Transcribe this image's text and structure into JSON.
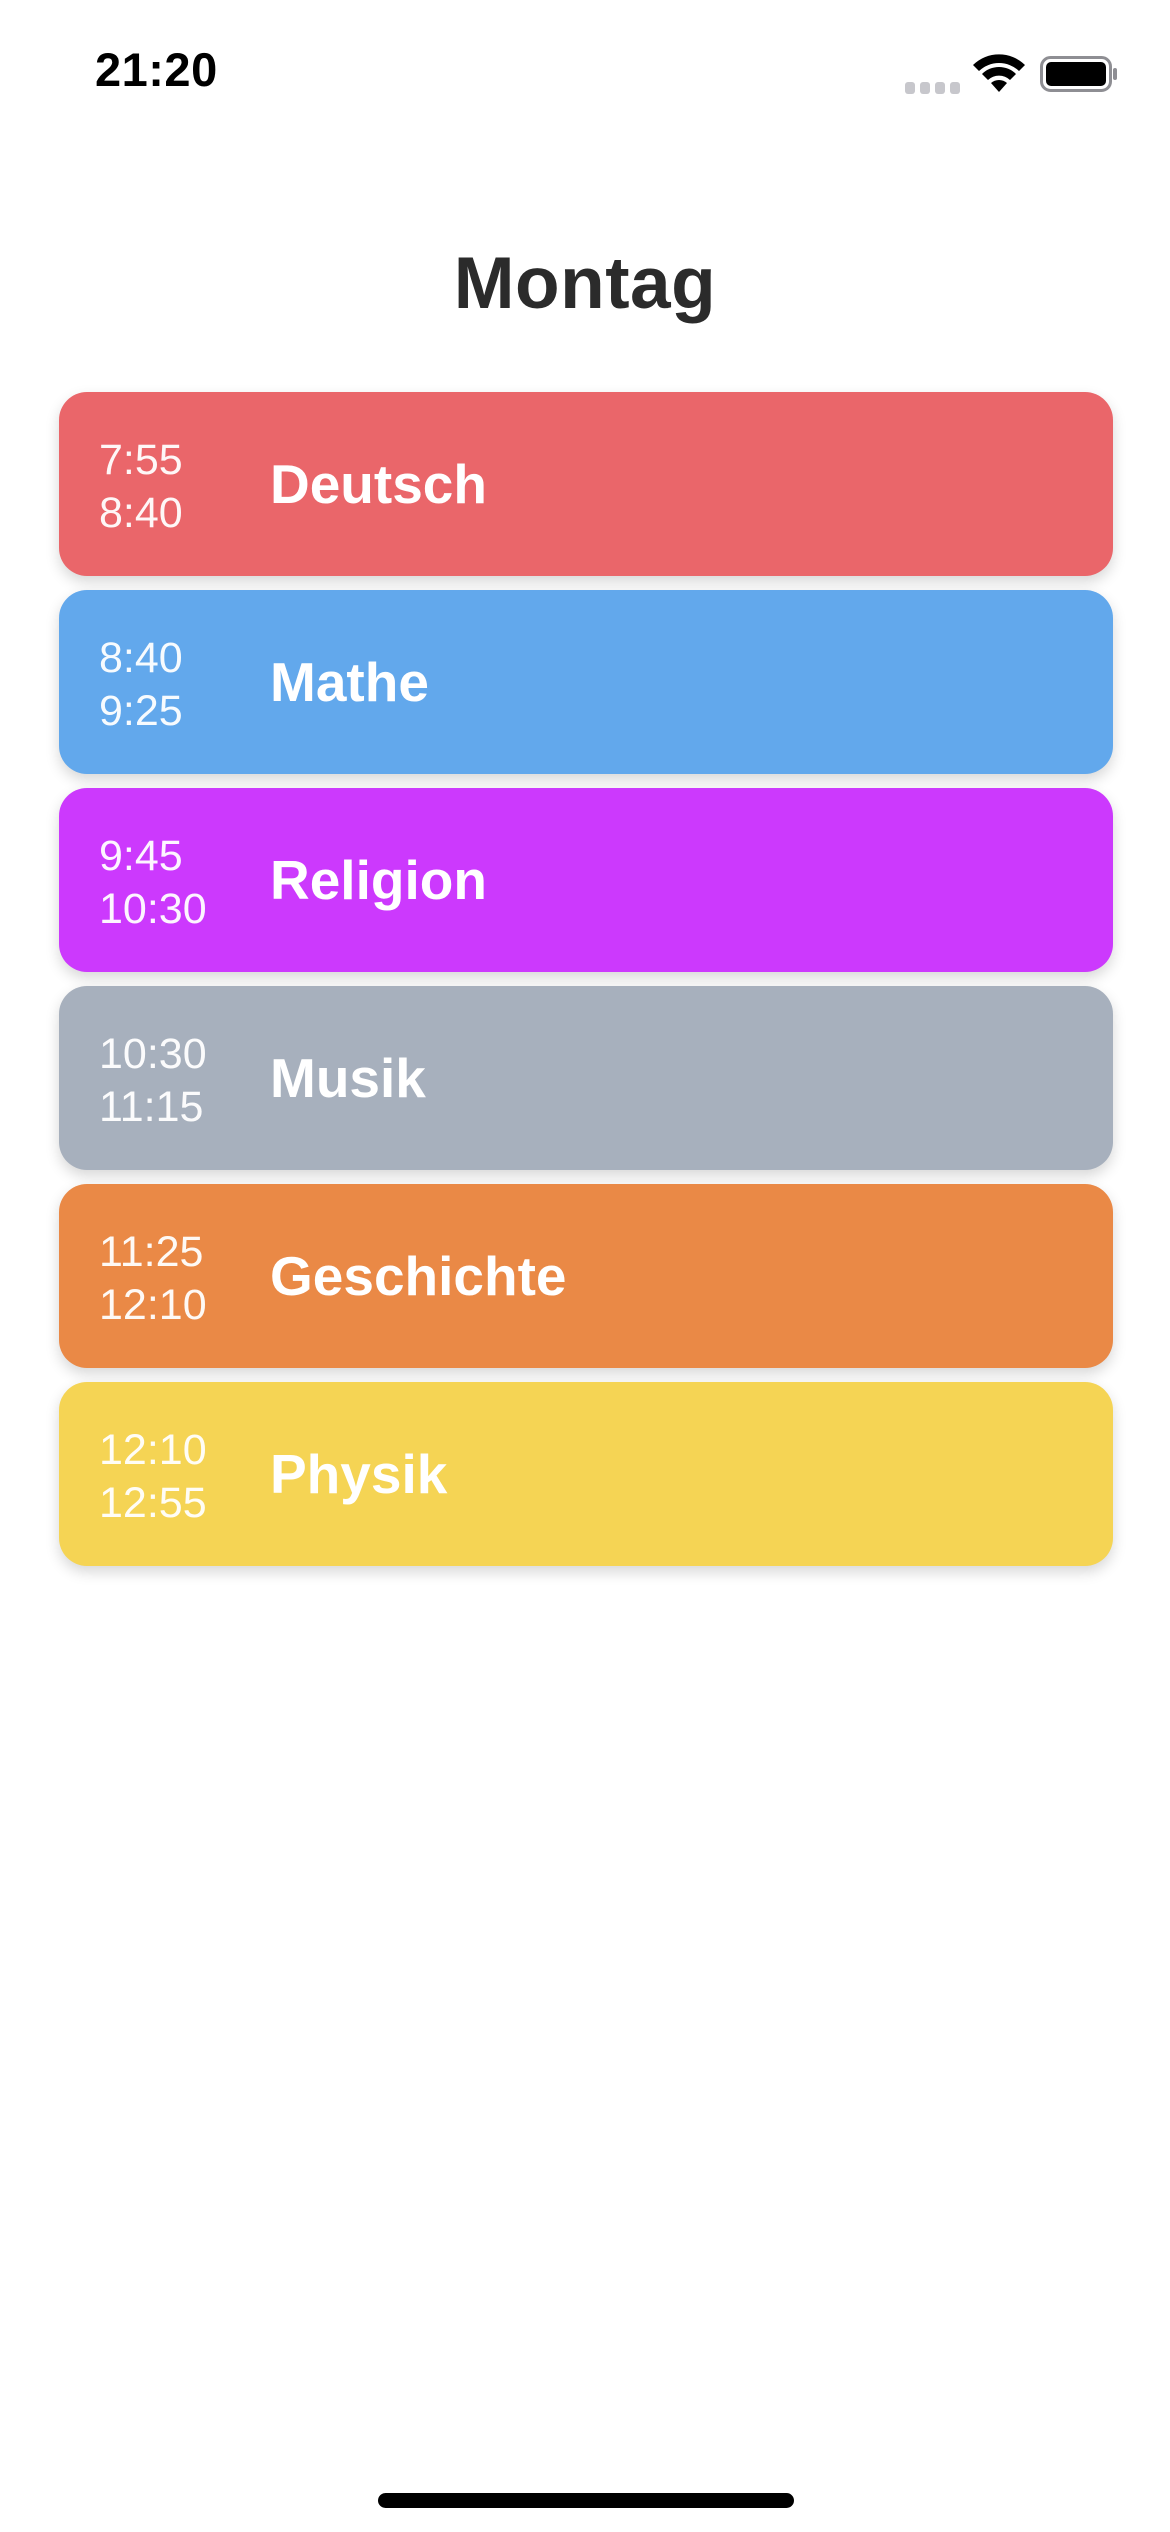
{
  "status_bar": {
    "time": "21:20",
    "icons": [
      "cellular-signal-icon",
      "wifi-icon",
      "battery-icon"
    ]
  },
  "page": {
    "title": "Montag"
  },
  "lessons": [
    {
      "start": "7:55",
      "end": "8:40",
      "subject": "Deutsch",
      "color": "#EA666A"
    },
    {
      "start": "8:40",
      "end": "9:25",
      "subject": "Mathe",
      "color": "#62A8EC"
    },
    {
      "start": "9:45",
      "end": "10:30",
      "subject": "Religion",
      "color": "#CC39FD"
    },
    {
      "start": "10:30",
      "end": "11:15",
      "subject": "Musik",
      "color": "#A7B0BD"
    },
    {
      "start": "11:25",
      "end": "12:10",
      "subject": "Geschichte",
      "color": "#EA8946"
    },
    {
      "start": "12:10",
      "end": "12:55",
      "subject": "Physik",
      "color": "#F5D454"
    }
  ]
}
